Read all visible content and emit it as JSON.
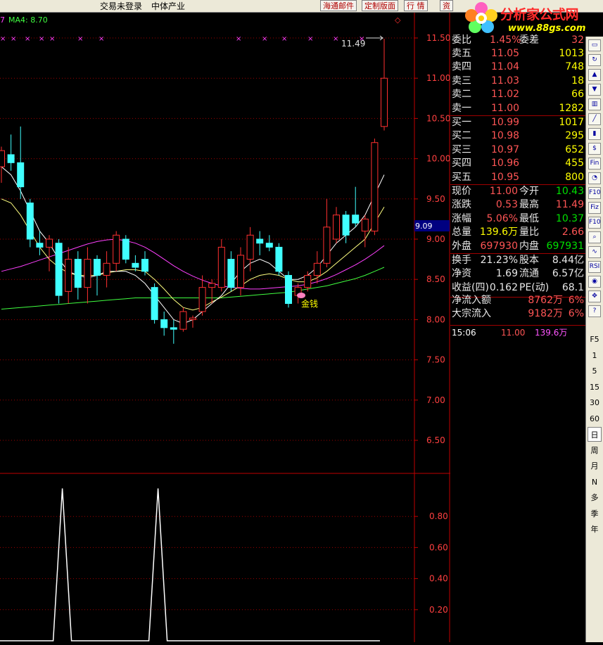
{
  "top_bar": {
    "login_status": "交易未登录",
    "sector": "中体产业",
    "btn_mail": "海通邮件",
    "btn_layout": "定制版面",
    "btn_quote": "行  情",
    "btn_info": "资"
  },
  "logo": {
    "name": "分析家公式网",
    "url": "www.88gs.com"
  },
  "chart": {
    "ma_label_prefix": "7",
    "ma_label": "MA4: 8.70",
    "corner_marker": "◇",
    "peak_label": "11.49",
    "signal_label": "金钱",
    "current_price_tag": "9.09",
    "price_axis": [
      "11.50",
      "11.00",
      "10.50",
      "10.00",
      "9.50",
      "9.00",
      "8.50",
      "8.00",
      "7.50",
      "7.00",
      "6.50"
    ],
    "indicator_axis": [
      "0.80",
      "0.60",
      "0.40",
      "0.20"
    ],
    "x_markers_label": "×",
    "colors": {
      "up": "#ff3030",
      "down": "#40ffff",
      "ma_short": "#ffffff",
      "ma_mid": "#ffff80",
      "ma_long": "#ff40ff",
      "ma_xlong": "#40ff40",
      "grid": "#a00000"
    }
  },
  "chart_data": {
    "type": "candlestick",
    "ylim": [
      6.2,
      11.8
    ],
    "candles": [
      {
        "o": 9.9,
        "h": 10.15,
        "l": 9.7,
        "c": 10.1
      },
      {
        "o": 10.05,
        "h": 10.3,
        "l": 9.85,
        "c": 9.95
      },
      {
        "o": 9.95,
        "h": 10.4,
        "l": 9.5,
        "c": 9.65
      },
      {
        "o": 9.45,
        "h": 9.5,
        "l": 8.9,
        "c": 9.0
      },
      {
        "o": 8.95,
        "h": 9.1,
        "l": 8.8,
        "c": 8.9
      },
      {
        "o": 8.9,
        "h": 9.05,
        "l": 8.6,
        "c": 9.0
      },
      {
        "o": 8.95,
        "h": 9.0,
        "l": 8.2,
        "c": 8.3
      },
      {
        "o": 8.35,
        "h": 8.9,
        "l": 8.2,
        "c": 8.75
      },
      {
        "o": 8.75,
        "h": 8.85,
        "l": 8.25,
        "c": 8.4
      },
      {
        "o": 8.4,
        "h": 8.9,
        "l": 8.2,
        "c": 8.75
      },
      {
        "o": 8.75,
        "h": 8.8,
        "l": 8.3,
        "c": 8.55
      },
      {
        "o": 8.55,
        "h": 8.85,
        "l": 8.4,
        "c": 8.7
      },
      {
        "o": 8.7,
        "h": 9.1,
        "l": 8.6,
        "c": 9.05
      },
      {
        "o": 9.0,
        "h": 9.05,
        "l": 8.7,
        "c": 8.75
      },
      {
        "o": 8.7,
        "h": 8.8,
        "l": 8.6,
        "c": 8.65
      },
      {
        "o": 8.75,
        "h": 8.85,
        "l": 8.55,
        "c": 8.6
      },
      {
        "o": 8.4,
        "h": 8.45,
        "l": 7.95,
        "c": 8.0
      },
      {
        "o": 8.0,
        "h": 8.1,
        "l": 7.8,
        "c": 7.9
      },
      {
        "o": 7.9,
        "h": 8.0,
        "l": 7.7,
        "c": 7.88
      },
      {
        "o": 7.88,
        "h": 8.15,
        "l": 7.85,
        "c": 8.1
      },
      {
        "o": 8.0,
        "h": 8.05,
        "l": 7.9,
        "c": 8.02
      },
      {
        "o": 8.1,
        "h": 8.55,
        "l": 8.05,
        "c": 8.4
      },
      {
        "o": 8.4,
        "h": 8.5,
        "l": 8.2,
        "c": 8.45
      },
      {
        "o": 8.4,
        "h": 9.0,
        "l": 8.35,
        "c": 8.9
      },
      {
        "o": 8.75,
        "h": 8.85,
        "l": 8.35,
        "c": 8.4
      },
      {
        "o": 8.4,
        "h": 8.9,
        "l": 8.3,
        "c": 8.8
      },
      {
        "o": 8.75,
        "h": 9.15,
        "l": 8.6,
        "c": 9.05
      },
      {
        "o": 9.0,
        "h": 9.1,
        "l": 8.8,
        "c": 8.95
      },
      {
        "o": 8.95,
        "h": 9.05,
        "l": 8.85,
        "c": 8.9
      },
      {
        "o": 8.9,
        "h": 8.95,
        "l": 8.55,
        "c": 8.6
      },
      {
        "o": 8.55,
        "h": 8.6,
        "l": 8.15,
        "c": 8.2
      },
      {
        "o": 8.3,
        "h": 8.45,
        "l": 8.2,
        "c": 8.4
      },
      {
        "o": 8.4,
        "h": 8.6,
        "l": 8.35,
        "c": 8.55
      },
      {
        "o": 8.55,
        "h": 8.85,
        "l": 8.45,
        "c": 8.7
      },
      {
        "o": 8.7,
        "h": 9.5,
        "l": 8.65,
        "c": 9.15
      },
      {
        "o": 9.0,
        "h": 9.4,
        "l": 8.95,
        "c": 9.3
      },
      {
        "o": 9.3,
        "h": 9.35,
        "l": 8.95,
        "c": 9.05
      },
      {
        "o": 9.3,
        "h": 9.65,
        "l": 9.15,
        "c": 9.2
      },
      {
        "o": 9.1,
        "h": 9.3,
        "l": 8.9,
        "c": 9.25
      },
      {
        "o": 9.1,
        "h": 10.25,
        "l": 9.05,
        "c": 10.2
      },
      {
        "o": 10.4,
        "h": 11.49,
        "l": 10.35,
        "c": 11.0
      }
    ],
    "ma_short": [
      9.9,
      9.8,
      9.6,
      9.35,
      9.1,
      8.95,
      8.75,
      8.6,
      8.55,
      8.52,
      8.55,
      8.6,
      8.6,
      8.6,
      8.55,
      8.45,
      8.3,
      8.15,
      8.0,
      7.95,
      8.0,
      8.1,
      8.2,
      8.3,
      8.45,
      8.6,
      8.7,
      8.75,
      8.7,
      8.6,
      8.5,
      8.5,
      8.55,
      8.65,
      8.8,
      8.95,
      9.05,
      9.15,
      9.3,
      9.55,
      9.8
    ],
    "ma_mid": [
      9.5,
      9.45,
      9.3,
      9.1,
      8.9,
      8.75,
      8.65,
      8.58,
      8.55,
      8.55,
      8.55,
      8.58,
      8.6,
      8.62,
      8.62,
      8.6,
      8.5,
      8.38,
      8.25,
      8.15,
      8.12,
      8.15,
      8.22,
      8.28,
      8.35,
      8.42,
      8.5,
      8.55,
      8.57,
      8.55,
      8.5,
      8.47,
      8.47,
      8.52,
      8.6,
      8.7,
      8.8,
      8.9,
      9.0,
      9.2,
      9.4
    ],
    "ma_long": [
      8.6,
      8.63,
      8.66,
      8.7,
      8.74,
      8.78,
      8.82,
      8.86,
      8.9,
      8.94,
      8.97,
      8.99,
      9.0,
      8.98,
      8.95,
      8.9,
      8.83,
      8.75,
      8.67,
      8.6,
      8.54,
      8.49,
      8.45,
      8.42,
      8.4,
      8.39,
      8.38,
      8.38,
      8.39,
      8.4,
      8.41,
      8.42,
      8.44,
      8.47,
      8.51,
      8.56,
      8.62,
      8.68,
      8.75,
      8.83,
      8.92
    ],
    "ma_xlong": [
      8.13,
      8.14,
      8.15,
      8.16,
      8.17,
      8.18,
      8.19,
      8.2,
      8.21,
      8.22,
      8.23,
      8.24,
      8.25,
      8.26,
      8.27,
      8.27,
      8.27,
      8.27,
      8.27,
      8.27,
      8.27,
      8.27,
      8.27,
      8.27,
      8.28,
      8.29,
      8.3,
      8.31,
      8.32,
      8.33,
      8.34,
      8.36,
      8.38,
      8.4,
      8.42,
      8.45,
      8.48,
      8.51,
      8.55,
      8.6,
      8.65
    ],
    "indicator": {
      "ylim": [
        0,
        1.0
      ],
      "spikes_at_candle": [
        6,
        16
      ]
    }
  },
  "quote": {
    "weibi": {
      "label": "委比",
      "value": "1.45%",
      "label2": "委差",
      "value2": "32"
    },
    "asks": [
      {
        "label": "卖五",
        "price": "11.05",
        "vol": "1013"
      },
      {
        "label": "卖四",
        "price": "11.04",
        "vol": "748"
      },
      {
        "label": "卖三",
        "price": "11.03",
        "vol": "18"
      },
      {
        "label": "卖二",
        "price": "11.02",
        "vol": "66"
      },
      {
        "label": "卖一",
        "price": "11.00",
        "vol": "1282"
      }
    ],
    "bids": [
      {
        "label": "买一",
        "price": "10.99",
        "vol": "1017"
      },
      {
        "label": "买二",
        "price": "10.98",
        "vol": "295"
      },
      {
        "label": "买三",
        "price": "10.97",
        "vol": "652"
      },
      {
        "label": "买四",
        "price": "10.96",
        "vol": "455"
      },
      {
        "label": "买五",
        "price": "10.95",
        "vol": "800"
      }
    ],
    "stats1": [
      {
        "l1": "现价",
        "v1": "11.00",
        "c1": "red",
        "l2": "今开",
        "v2": "10.43",
        "c2": "grn"
      },
      {
        "l1": "涨跌",
        "v1": "0.53",
        "c1": "red",
        "l2": "最高",
        "v2": "11.49",
        "c2": "red"
      },
      {
        "l1": "涨幅",
        "v1": "5.06%",
        "c1": "red",
        "l2": "最低",
        "v2": "10.37",
        "c2": "grn"
      },
      {
        "l1": "总量",
        "v1": "139.6万",
        "c1": "yel",
        "l2": "量比",
        "v2": "2.66",
        "c2": "red"
      },
      {
        "l1": "外盘",
        "v1": "697930",
        "c1": "red",
        "l2": "内盘",
        "v2": "697931",
        "c2": "grn"
      }
    ],
    "stats2": [
      {
        "l1": "换手",
        "v1": "21.23%",
        "l2": "股本",
        "v2": "8.44亿"
      },
      {
        "l1": "净资",
        "v1": "1.69",
        "l2": "流通",
        "v2": "6.57亿"
      },
      {
        "l1": "收益(四)",
        "v1": "0.162",
        "l2": "PE(动)",
        "v2": "68.1"
      }
    ],
    "flows": [
      {
        "label": "净流入额",
        "value": "8762万",
        "pct": "6%"
      },
      {
        "label": "大宗流入",
        "value": "9182万",
        "pct": "6%"
      }
    ],
    "tick": {
      "time": "15:06",
      "price": "11.00",
      "vol": "139.6万"
    }
  },
  "toolbar": {
    "icons": [
      "window-icon",
      "refresh-icon",
      "up-arrow-icon",
      "down-arrow-icon",
      "chart-icon",
      "line-chart-icon",
      "kline-icon",
      "money-icon",
      "fin-icon",
      "pie-icon",
      "f10-icon",
      "fiz-icon",
      "f10b-icon",
      "zoom-icon",
      "wave-icon",
      "rsi-icon",
      "pin-icon",
      "cross-icon",
      "help-icon"
    ],
    "periods": [
      "F5",
      "1",
      "5",
      "15",
      "30",
      "60",
      "日",
      "周",
      "月",
      "N",
      "多",
      "季",
      "年"
    ]
  }
}
